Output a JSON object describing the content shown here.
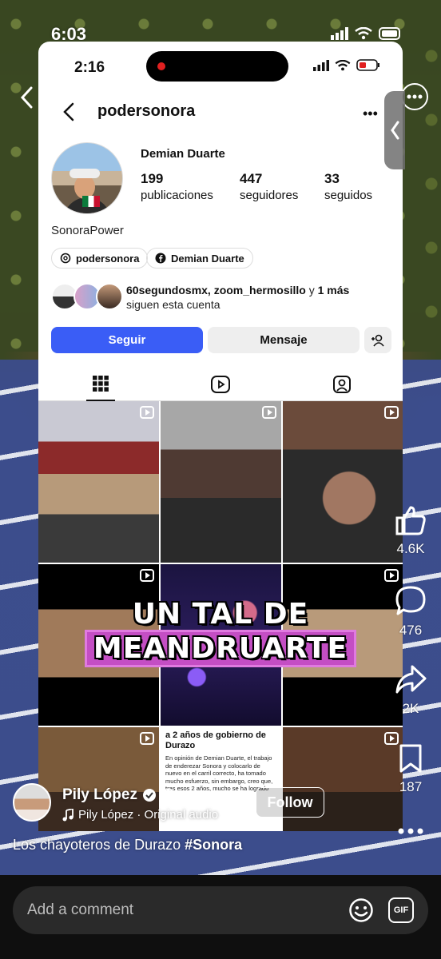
{
  "tiktok": {
    "time": "6:03",
    "author": {
      "name": "Pily López",
      "audio": "Pily López · Original audio"
    },
    "follow_label": "Follow",
    "caption": {
      "text": "Los chayoteros de Durazo ",
      "hashtag": "#Sonora"
    },
    "actions": {
      "likes": "4.6K",
      "comments": "476",
      "shares": "2K",
      "saves": "187"
    },
    "comment_placeholder": "Add a comment",
    "gif_label": "GIF"
  },
  "instagram": {
    "time": "2:16",
    "username": "podersonora",
    "display_name": "Demian Duarte",
    "stats": [
      {
        "value": "199",
        "label": "publicaciones"
      },
      {
        "value": "447",
        "label": "seguidores"
      },
      {
        "value": "33",
        "label": "seguidos"
      }
    ],
    "bio": "SonoraPower",
    "chips": [
      "podersonora",
      "Demian Duarte"
    ],
    "followed_by": {
      "names": "60segundosmx, zoom_hermosillo",
      "conj": " y ",
      "more": "1 más",
      "line2": "siguen esta cuenta"
    },
    "buttons": {
      "follow": "Seguir",
      "message": "Mensaje"
    },
    "overlay_text": {
      "line1": "UN TAL DE",
      "line2": "MEANDRUARTE"
    },
    "news_post": {
      "title": "a 2 años de gobierno de Durazo",
      "body": "En opinión de Demian Duarte, el trabajo de enderezar Sonora y colocarlo de nuevo en el carril correcto, ha tomado mucho esfuerzo, sin embargo, creo que, tras esos 2 años, mucho se ha logrado"
    }
  },
  "colors": {
    "follow_blue": "#3a5df6",
    "overlay_pink": "#c44ec4"
  }
}
